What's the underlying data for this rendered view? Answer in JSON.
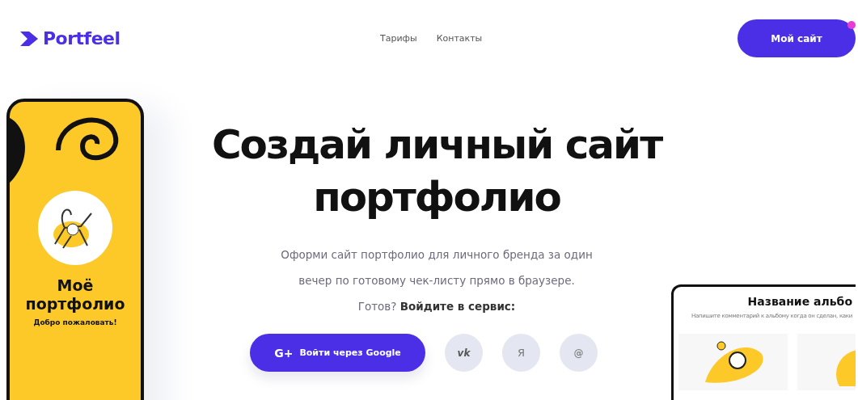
{
  "header": {
    "logo": "Portfeel",
    "nav": [
      {
        "label": "Тарифы"
      },
      {
        "label": "Контакты"
      }
    ],
    "cta": {
      "label": "Мой сайт",
      "notification_dot": true
    }
  },
  "phone": {
    "title": "Моё портфолио",
    "subtitle": "Добро пожаловать!"
  },
  "hero": {
    "title": "Создай личный сайт портфолио",
    "description": "Оформи сайт портфолио для личного бренда за один вечер по готовому чек-листу прямо в браузере.",
    "prompt": "Готов? **Войдите в сервис:**"
  },
  "login": {
    "google": {
      "icon": "G+",
      "label": "Войти через Google"
    },
    "socials": [
      {
        "kind": "vk",
        "label": "vk"
      },
      {
        "kind": "yandex",
        "label": "Я"
      },
      {
        "kind": "email",
        "label": "@"
      }
    ]
  },
  "tablet": {
    "title": "Название альбо",
    "note": "Напишите комментарий к альбому когда он сделан, каки"
  }
}
